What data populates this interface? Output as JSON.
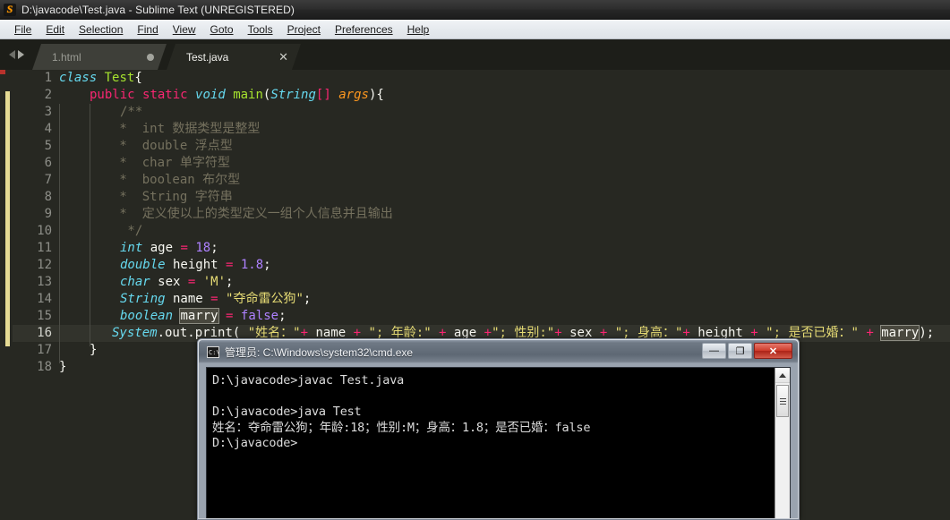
{
  "window": {
    "title": "D:\\javacode\\Test.java - Sublime Text (UNREGISTERED)",
    "logo_icon": "sublime-logo-icon"
  },
  "menubar": {
    "items": [
      {
        "label": "File"
      },
      {
        "label": "Edit"
      },
      {
        "label": "Selection"
      },
      {
        "label": "Find"
      },
      {
        "label": "View"
      },
      {
        "label": "Goto"
      },
      {
        "label": "Tools"
      },
      {
        "label": "Project"
      },
      {
        "label": "Preferences"
      },
      {
        "label": "Help"
      }
    ]
  },
  "tabs": {
    "nav_prev_icon": "arrow-left-icon",
    "nav_next_icon": "arrow-right-icon",
    "items": [
      {
        "label": "1.html",
        "active": false,
        "modified": true,
        "indicator": "modified-dot-icon"
      },
      {
        "label": "Test.java",
        "active": true,
        "modified": false,
        "close_icon": "close-icon"
      }
    ]
  },
  "editor": {
    "line_numbers": [
      "1",
      "2",
      "3",
      "4",
      "5",
      "6",
      "7",
      "8",
      "9",
      "10",
      "11",
      "12",
      "13",
      "14",
      "15",
      "16",
      "17",
      "18"
    ],
    "active_line": 16,
    "selection_token": "marry",
    "lines": [
      {
        "n": 1,
        "text": "class Test{"
      },
      {
        "n": 2,
        "text": "    public static void main(String[] args){"
      },
      {
        "n": 3,
        "text": "        /**"
      },
      {
        "n": 4,
        "text": "         *  int 数据类型是整型"
      },
      {
        "n": 5,
        "text": "         *  double 浮点型"
      },
      {
        "n": 6,
        "text": "         *  char 单字符型"
      },
      {
        "n": 7,
        "text": "         *  boolean 布尔型"
      },
      {
        "n": 8,
        "text": "         *  String 字符串"
      },
      {
        "n": 9,
        "text": "         *  定义使以上的类型定义一组个人信息并且输出"
      },
      {
        "n": 10,
        "text": "         */"
      },
      {
        "n": 11,
        "text": "        int age = 18;"
      },
      {
        "n": 12,
        "text": "        double height = 1.8;"
      },
      {
        "n": 13,
        "text": "        char sex = 'M';"
      },
      {
        "n": 14,
        "text": "        String name = \"夺命雷公狗\";"
      },
      {
        "n": 15,
        "text": "        boolean marry = false;"
      },
      {
        "n": 16,
        "text": "        System.out.print( \"姓名：\"+ name + \"; 年龄:\" + age +\"; 性别:\"+ sex + \"; 身高：\"+ height + \"; 是否已婚：\" + marry);"
      },
      {
        "n": 17,
        "text": "    }"
      },
      {
        "n": 18,
        "text": "}"
      }
    ],
    "tokens": {
      "l1": {
        "kw": "class",
        "name": "Test",
        "brace": "{"
      },
      "l2": {
        "mod1": "public",
        "mod2": "static",
        "ret": "void",
        "fn": "main",
        "type": "String",
        "brackets": "[]",
        "param": "args",
        "tail": "){"
      },
      "l3": "/**",
      "l4": " *  int 数据类型是整型",
      "l5": " *  double 浮点型",
      "l6": " *  char 单字符型",
      "l7": " *  boolean 布尔型",
      "l8": " *  String 字符串",
      "l9": " *  定义使以上的类型定义一组个人信息并且输出",
      "l10": " */",
      "l11": {
        "type": "int",
        "var": " age ",
        "op": "=",
        "val": " 18",
        "semi": ";"
      },
      "l12": {
        "type": "double",
        "var": " height ",
        "op": "=",
        "val": " 1.8",
        "semi": ";"
      },
      "l13": {
        "type": "char",
        "var": " sex ",
        "op": "=",
        "val": " 'M'",
        "semi": ";"
      },
      "l14": {
        "type": "String",
        "var": " name ",
        "op": "=",
        "val": " \"夺命雷公狗\"",
        "semi": ";"
      },
      "l15": {
        "type": "boolean",
        "var": "marry",
        "op": " = ",
        "val": "false",
        "semi": ";"
      },
      "l16": {
        "sys": "System",
        "dot1": ".out",
        "dot2": ".print",
        "open": "( ",
        "s1": "\"姓名：\"",
        "p1": "+",
        "v1": " name ",
        "p2": "+",
        "s2": " \"; 年龄:\"",
        "p3": " + ",
        "v2": "age",
        "p4": " +",
        "s3": "\"; 性别:\"",
        "p5": "+",
        "v3": " sex ",
        "p6": "+",
        "s4": " \"; 身高：\"",
        "p7": "+",
        "v4": " height ",
        "p8": "+",
        "s5": " \"; 是否已婚：\"",
        "p9": " + ",
        "v5": "marry",
        "close": ");"
      },
      "l17": "}",
      "l18": "}"
    }
  },
  "cmd": {
    "title": "管理员: C:\\Windows\\system32\\cmd.exe",
    "icon": "cmd-icon",
    "buttons": {
      "minimize": "—",
      "maximize": "❐",
      "close": "✕",
      "minimize_name": "minimize-button",
      "maximize_name": "maximize-button",
      "close_name": "close-button"
    },
    "console_lines": [
      "D:\\javacode>javac Test.java",
      "",
      "D:\\javacode>java Test",
      "姓名：夺命雷公狗；年龄:18；性别:M；身高：1.8；是否已婚：false",
      "D:\\javacode>"
    ],
    "scrollbar": {
      "up_icon": "scroll-up-arrow-icon",
      "thumb": "scroll-thumb"
    }
  },
  "colors": {
    "editor_bg": "#272822",
    "keyword": "#f92672",
    "type": "#66d9ef",
    "function": "#a6e22e",
    "string": "#e6db74",
    "number": "#ae81ff",
    "comment": "#75715e",
    "param": "#fd971f",
    "fold_bar": "#e6db94",
    "accent_close": "#cf3c2c"
  }
}
